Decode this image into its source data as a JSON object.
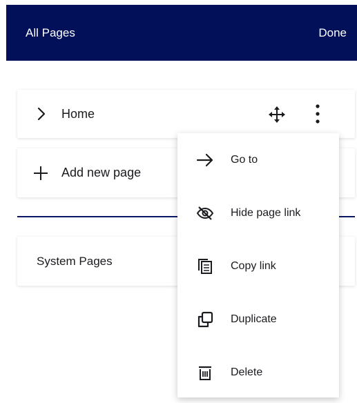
{
  "header": {
    "title": "All Pages",
    "done_label": "Done"
  },
  "pages": {
    "home": {
      "label": "Home"
    },
    "add_new": {
      "label": "Add new page"
    },
    "system": {
      "label": "System Pages"
    }
  },
  "context_menu": {
    "items": [
      {
        "label": "Go to",
        "icon": "arrow-right-icon"
      },
      {
        "label": "Hide page link",
        "icon": "eye-slash-icon"
      },
      {
        "label": "Copy link",
        "icon": "copy-icon"
      },
      {
        "label": "Duplicate",
        "icon": "duplicate-icon"
      },
      {
        "label": "Delete",
        "icon": "trash-icon"
      }
    ]
  },
  "colors": {
    "header_bg": "#02105a",
    "divider": "#0b1566"
  }
}
